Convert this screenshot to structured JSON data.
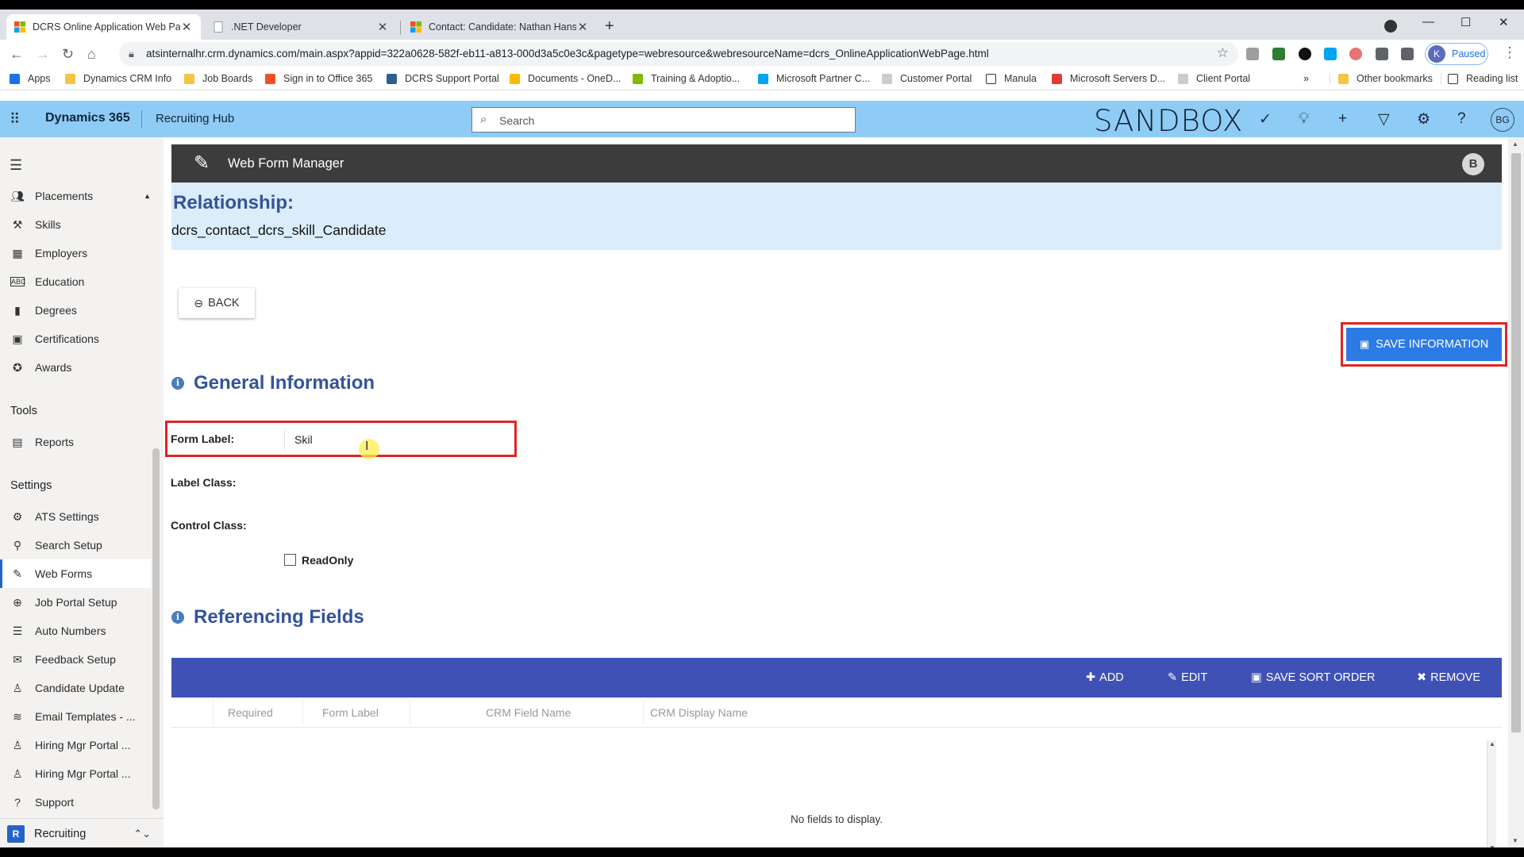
{
  "browser": {
    "tabs": [
      {
        "title": "DCRS Online Application Web Page",
        "active": true
      },
      {
        "title": ".NET Developer",
        "active": false
      },
      {
        "title": "Contact: Candidate: Nathan Hanson",
        "active": false
      }
    ],
    "url": "atsinternalhr.crm.dynamics.com/main.aspx?appid=322a0628-582f-eb11-a813-000d3a5c0e3c&pagetype=webresource&webresourceName=dcrs_OnlineApplicationWebPage.html",
    "profile_initial": "K",
    "profile_status": "Paused",
    "bookmarks": [
      "Apps",
      "Dynamics CRM Info",
      "Job Boards",
      "Sign in to Office 365",
      "DCRS Support Portal",
      "Documents - OneD...",
      "Training & Adoptio...",
      "Microsoft Partner C...",
      "Customer Portal",
      "Manula",
      "Microsoft Servers D...",
      "Client Portal"
    ],
    "bookmarks_overflow": "»",
    "other_bookmarks": "Other bookmarks",
    "reading_list": "Reading list"
  },
  "d365": {
    "product": "Dynamics 365",
    "app": "Recruiting Hub",
    "search_placeholder": "Search",
    "environment": "SANDBOX",
    "user_initials": "BG"
  },
  "leftnav": {
    "group1": [
      {
        "label": "Placements",
        "icon": "people-icon"
      },
      {
        "label": "Skills",
        "icon": "tools-icon"
      },
      {
        "label": "Employers",
        "icon": "building-icon"
      },
      {
        "label": "Education",
        "icon": "abc-icon"
      },
      {
        "label": "Degrees",
        "icon": "book-icon"
      },
      {
        "label": "Certifications",
        "icon": "certificate-icon"
      },
      {
        "label": "Awards",
        "icon": "award-icon"
      }
    ],
    "tools_header": "Tools",
    "tools": [
      {
        "label": "Reports",
        "icon": "report-icon"
      }
    ],
    "settings_header": "Settings",
    "settings": [
      {
        "label": "ATS Settings",
        "icon": "gear-icon"
      },
      {
        "label": "Search Setup",
        "icon": "search-setup-icon"
      },
      {
        "label": "Web Forms",
        "icon": "web-form-icon",
        "selected": true
      },
      {
        "label": "Job Portal Setup",
        "icon": "globe-icon"
      },
      {
        "label": "Auto Numbers",
        "icon": "list-icon"
      },
      {
        "label": "Feedback Setup",
        "icon": "feedback-icon"
      },
      {
        "label": "Candidate Update",
        "icon": "person-update-icon"
      },
      {
        "label": "Email Templates - ...",
        "icon": "layers-icon"
      },
      {
        "label": "Hiring Mgr Portal ...",
        "icon": "person-icon"
      },
      {
        "label": "Hiring Mgr Portal ...",
        "icon": "person-icon"
      },
      {
        "label": "Support",
        "icon": "help-icon"
      }
    ],
    "area_badge": "R",
    "area_label": "Recruiting"
  },
  "wfm": {
    "title": "Web Form Manager",
    "badge": "B",
    "relationship_label": "Relationship:",
    "relationship_name": "dcrs_contact_dcrs_skill_Candidate",
    "back_label": "BACK",
    "save_label": "SAVE INFORMATION",
    "general_title": "General Information",
    "form_label": "Form Label:",
    "form_label_value": "Skil",
    "label_class": "Label Class:",
    "control_class": "Control Class:",
    "readonly_label": "ReadOnly",
    "referencing_title": "Referencing Fields",
    "grid_actions": {
      "add": "ADD",
      "edit": "EDIT",
      "save_sort": "SAVE SORT ORDER",
      "remove": "REMOVE"
    },
    "grid_columns": [
      "Required",
      "Form Label",
      "CRM Field Name",
      "CRM Display Name"
    ],
    "empty_text": "No fields to display."
  },
  "colors": {
    "accent": "#2c7be5",
    "grid_toolbar": "#3f51b5",
    "highlight": "#e02424",
    "d365_bar": "#8ecbf5",
    "title": "#34549a"
  }
}
